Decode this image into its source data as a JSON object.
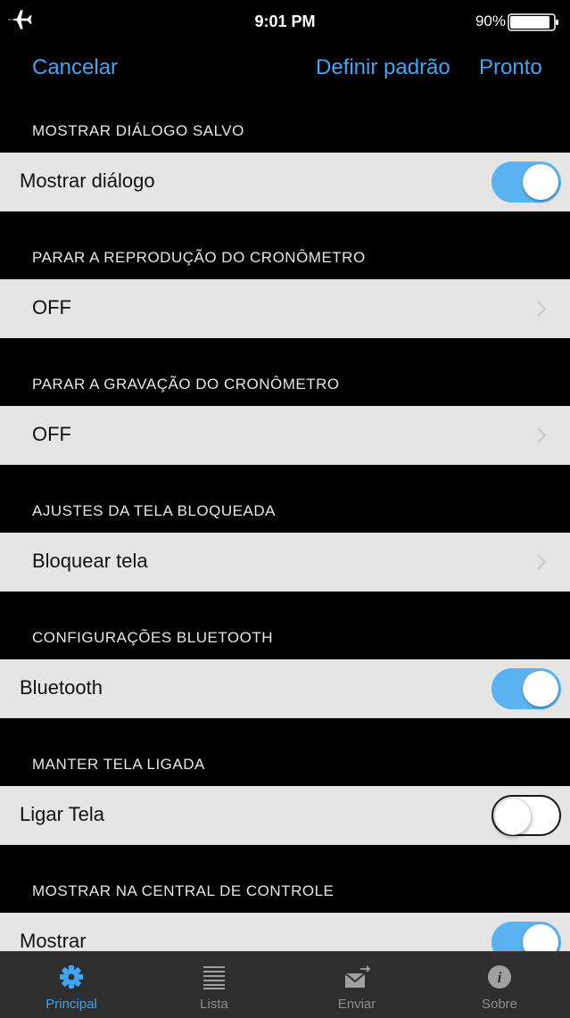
{
  "status_bar": {
    "time": "9:01 PM",
    "battery": "90%"
  },
  "nav": {
    "cancel": "Cancelar",
    "set_default": "Definir padrão",
    "done": "Pronto"
  },
  "sections": [
    {
      "header": "MOSTRAR DIÁLOGO SALVO",
      "row_label": "Mostrar diálogo",
      "control": "toggle",
      "on": true
    },
    {
      "header": "PARAR A REPRODUÇÃO DO CRONÔMETRO",
      "row_label": "OFF",
      "control": "disclosure"
    },
    {
      "header": "PARAR A GRAVAÇÃO DO CRONÔMETRO",
      "row_label": "OFF",
      "control": "disclosure"
    },
    {
      "header": "AJUSTES DA TELA BLOQUEADA",
      "row_label": "Bloquear tela",
      "control": "disclosure"
    },
    {
      "header": "CONFIGURAÇÕES BLUETOOTH",
      "row_label": "Bluetooth",
      "control": "toggle",
      "on": true
    },
    {
      "header": "MANTER TELA LIGADA",
      "row_label": "Ligar Tela",
      "control": "toggle",
      "on": false
    },
    {
      "header": "MOSTRAR NA CENTRAL DE CONTROLE",
      "row_label": "Mostrar",
      "control": "toggle",
      "on": true
    }
  ],
  "tabs": [
    {
      "label": "Principal",
      "icon": "gear-icon",
      "active": true
    },
    {
      "label": "Lista",
      "icon": "list-icon",
      "active": false
    },
    {
      "label": "Enviar",
      "icon": "send-mail-icon",
      "active": false
    },
    {
      "label": "Sobre",
      "icon": "info-icon",
      "active": false
    }
  ],
  "colors": {
    "accent": "#3fa6f5",
    "toggle_on": "#5ab3f0",
    "row_bg": "#e5e5e5",
    "tabbar_bg": "#2e2e2e"
  }
}
